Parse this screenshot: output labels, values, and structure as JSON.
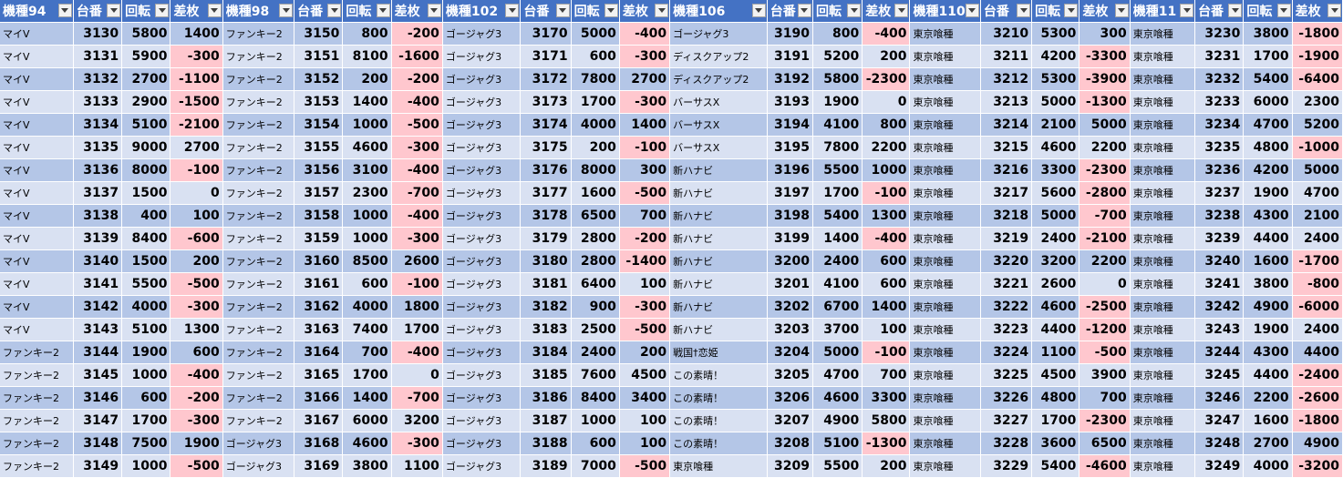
{
  "sheet": {
    "headers": [
      "機種94",
      "台番号",
      "回転数",
      "差枚数",
      "機種98",
      "台番号",
      "回転数",
      "差枚数",
      "機種102",
      "台番号",
      "回転数",
      "差枚数",
      "機種106",
      "台番号",
      "回転数",
      "差枚数",
      "機種110",
      "台番号",
      "回転数",
      "差枚数",
      "機種11",
      "台番号",
      "回転数",
      "差枚数"
    ],
    "header_display": [
      "機種94",
      "台番",
      "回転",
      "差枚",
      "機種98",
      "台番",
      "回転",
      "差枚",
      "機種102",
      "台番",
      "回転",
      "差枚",
      "機種106",
      "台番",
      "回転",
      "差枚",
      "機種110",
      "台番",
      "回転",
      "差枚",
      "機種11",
      "台番",
      "回転",
      "差枚"
    ],
    "rows": [
      [
        "マイV",
        "3130",
        "5800",
        "1400",
        "ファンキー2",
        "3150",
        "800",
        "-200",
        "ゴージャグ3",
        "3170",
        "5000",
        "-400",
        "ゴージャグ3",
        "3190",
        "800",
        "-400",
        "東京喰種",
        "3210",
        "5300",
        "300",
        "東京喰種",
        "3230",
        "3800",
        "-1800"
      ],
      [
        "マイV",
        "3131",
        "5900",
        "-300",
        "ファンキー2",
        "3151",
        "8100",
        "-1600",
        "ゴージャグ3",
        "3171",
        "600",
        "-300",
        "ディスクアップ2",
        "3191",
        "5200",
        "200",
        "東京喰種",
        "3211",
        "4200",
        "-3300",
        "東京喰種",
        "3231",
        "1700",
        "-1900"
      ],
      [
        "マイV",
        "3132",
        "2700",
        "-1100",
        "ファンキー2",
        "3152",
        "200",
        "-200",
        "ゴージャグ3",
        "3172",
        "7800",
        "2700",
        "ディスクアップ2",
        "3192",
        "5800",
        "-2300",
        "東京喰種",
        "3212",
        "5300",
        "-3900",
        "東京喰種",
        "3232",
        "5400",
        "-6400"
      ],
      [
        "マイV",
        "3133",
        "2900",
        "-1500",
        "ファンキー2",
        "3153",
        "1400",
        "-400",
        "ゴージャグ3",
        "3173",
        "1700",
        "-300",
        "バーサスX",
        "3193",
        "1900",
        "0",
        "東京喰種",
        "3213",
        "5000",
        "-1300",
        "東京喰種",
        "3233",
        "6000",
        "2300"
      ],
      [
        "マイV",
        "3134",
        "5100",
        "-2100",
        "ファンキー2",
        "3154",
        "1000",
        "-500",
        "ゴージャグ3",
        "3174",
        "4000",
        "1400",
        "バーサスX",
        "3194",
        "4100",
        "800",
        "東京喰種",
        "3214",
        "2100",
        "5000",
        "東京喰種",
        "3234",
        "4700",
        "5200"
      ],
      [
        "マイV",
        "3135",
        "9000",
        "2700",
        "ファンキー2",
        "3155",
        "4600",
        "-300",
        "ゴージャグ3",
        "3175",
        "200",
        "-100",
        "バーサスX",
        "3195",
        "7800",
        "2200",
        "東京喰種",
        "3215",
        "4600",
        "2200",
        "東京喰種",
        "3235",
        "4800",
        "-1000"
      ],
      [
        "マイV",
        "3136",
        "8000",
        "-100",
        "ファンキー2",
        "3156",
        "3100",
        "-400",
        "ゴージャグ3",
        "3176",
        "8000",
        "300",
        "新ハナビ",
        "3196",
        "5500",
        "1000",
        "東京喰種",
        "3216",
        "3300",
        "-2300",
        "東京喰種",
        "3236",
        "4200",
        "5000"
      ],
      [
        "マイV",
        "3137",
        "1500",
        "0",
        "ファンキー2",
        "3157",
        "2300",
        "-700",
        "ゴージャグ3",
        "3177",
        "1600",
        "-500",
        "新ハナビ",
        "3197",
        "1700",
        "-100",
        "東京喰種",
        "3217",
        "5600",
        "-2800",
        "東京喰種",
        "3237",
        "1900",
        "4700"
      ],
      [
        "マイV",
        "3138",
        "400",
        "100",
        "ファンキー2",
        "3158",
        "1000",
        "-400",
        "ゴージャグ3",
        "3178",
        "6500",
        "700",
        "新ハナビ",
        "3198",
        "5400",
        "1300",
        "東京喰種",
        "3218",
        "5000",
        "-700",
        "東京喰種",
        "3238",
        "4300",
        "2100"
      ],
      [
        "マイV",
        "3139",
        "8400",
        "-600",
        "ファンキー2",
        "3159",
        "1000",
        "-300",
        "ゴージャグ3",
        "3179",
        "2800",
        "-200",
        "新ハナビ",
        "3199",
        "1400",
        "-400",
        "東京喰種",
        "3219",
        "2400",
        "-2100",
        "東京喰種",
        "3239",
        "4400",
        "2400"
      ],
      [
        "マイV",
        "3140",
        "1500",
        "200",
        "ファンキー2",
        "3160",
        "8500",
        "2600",
        "ゴージャグ3",
        "3180",
        "2800",
        "-1400",
        "新ハナビ",
        "3200",
        "2400",
        "600",
        "東京喰種",
        "3220",
        "3200",
        "2200",
        "東京喰種",
        "3240",
        "1600",
        "-1700"
      ],
      [
        "マイV",
        "3141",
        "5500",
        "-500",
        "ファンキー2",
        "3161",
        "600",
        "-100",
        "ゴージャグ3",
        "3181",
        "6400",
        "100",
        "新ハナビ",
        "3201",
        "4100",
        "600",
        "東京喰種",
        "3221",
        "2600",
        "0",
        "東京喰種",
        "3241",
        "3800",
        "-800"
      ],
      [
        "マイV",
        "3142",
        "4000",
        "-300",
        "ファンキー2",
        "3162",
        "4000",
        "1800",
        "ゴージャグ3",
        "3182",
        "900",
        "-300",
        "新ハナビ",
        "3202",
        "6700",
        "1400",
        "東京喰種",
        "3222",
        "4600",
        "-2500",
        "東京喰種",
        "3242",
        "4900",
        "-6000"
      ],
      [
        "マイV",
        "3143",
        "5100",
        "1300",
        "ファンキー2",
        "3163",
        "7400",
        "1700",
        "ゴージャグ3",
        "3183",
        "2500",
        "-500",
        "新ハナビ",
        "3203",
        "3700",
        "100",
        "東京喰種",
        "3223",
        "4400",
        "-1200",
        "東京喰種",
        "3243",
        "1900",
        "2400"
      ],
      [
        "ファンキー2",
        "3144",
        "1900",
        "600",
        "ファンキー2",
        "3164",
        "700",
        "-400",
        "ゴージャグ3",
        "3184",
        "2400",
        "200",
        "戦国†恋姫",
        "3204",
        "5000",
        "-100",
        "東京喰種",
        "3224",
        "1100",
        "-500",
        "東京喰種",
        "3244",
        "4300",
        "4400"
      ],
      [
        "ファンキー2",
        "3145",
        "1000",
        "-400",
        "ファンキー2",
        "3165",
        "1700",
        "0",
        "ゴージャグ3",
        "3185",
        "7600",
        "4500",
        "この素晴！",
        "3205",
        "4700",
        "700",
        "東京喰種",
        "3225",
        "4500",
        "3900",
        "東京喰種",
        "3245",
        "4400",
        "-2400"
      ],
      [
        "ファンキー2",
        "3146",
        "600",
        "-200",
        "ファンキー2",
        "3166",
        "1400",
        "-700",
        "ゴージャグ3",
        "3186",
        "8400",
        "3400",
        "この素晴！",
        "3206",
        "4600",
        "3300",
        "東京喰種",
        "3226",
        "4800",
        "700",
        "東京喰種",
        "3246",
        "2200",
        "-2600"
      ],
      [
        "ファンキー2",
        "3147",
        "1700",
        "-300",
        "ファンキー2",
        "3167",
        "6000",
        "3200",
        "ゴージャグ3",
        "3187",
        "1000",
        "100",
        "この素晴！",
        "3207",
        "4900",
        "5800",
        "東京喰種",
        "3227",
        "1700",
        "-2300",
        "東京喰種",
        "3247",
        "1600",
        "-1800"
      ],
      [
        "ファンキー2",
        "3148",
        "7500",
        "1900",
        "ゴージャグ3",
        "3168",
        "4600",
        "-300",
        "ゴージャグ3",
        "3188",
        "600",
        "100",
        "この素晴！",
        "3208",
        "5100",
        "-1300",
        "東京喰種",
        "3228",
        "3600",
        "6500",
        "東京喰種",
        "3248",
        "2700",
        "4900"
      ],
      [
        "ファンキー2",
        "3149",
        "1000",
        "-500",
        "ゴージャグ3",
        "3169",
        "3800",
        "1100",
        "ゴージャグ3",
        "3189",
        "7000",
        "-500",
        "東京喰種",
        "3209",
        "5500",
        "200",
        "東京喰種",
        "3229",
        "5400",
        "-4600",
        "東京喰種",
        "3249",
        "4000",
        "-3200"
      ]
    ]
  },
  "colors": {
    "header_bg": "#4472c4",
    "row_odd": "#b4c6e7",
    "row_even": "#d9e1f2",
    "negative_highlight": "#ffc7ce"
  },
  "icons": {
    "filter": "dropdown-filter-icon"
  }
}
